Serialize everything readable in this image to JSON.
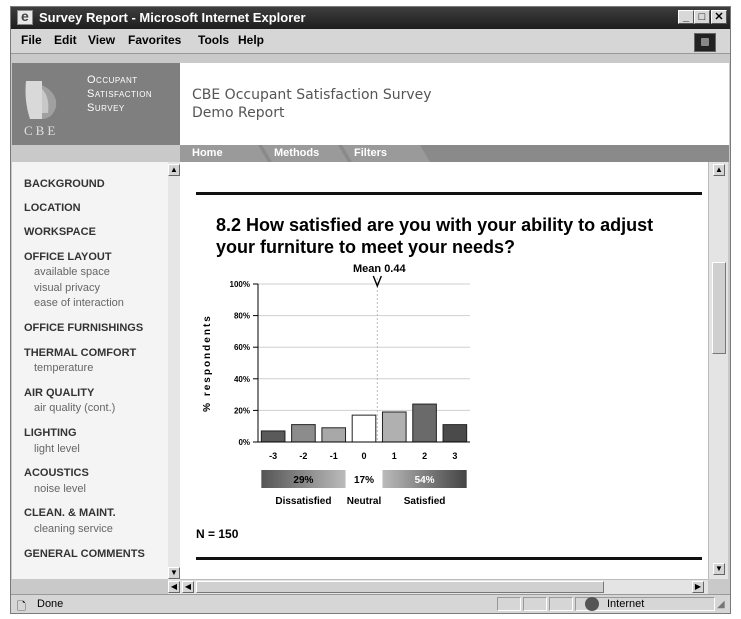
{
  "window": {
    "title": "Survey Report - Microsoft Internet Explorer",
    "controls": [
      "_",
      "□",
      "✕"
    ]
  },
  "menu": [
    "File",
    "Edit",
    "View",
    "Favorites",
    "Tools",
    "Help"
  ],
  "header": {
    "logo_lines": [
      "Occupant",
      "Satisfaction",
      "Survey"
    ],
    "logo_mark": "CBE",
    "title_line1": "CBE Occupant Satisfaction Survey",
    "title_line2": "Demo Report"
  },
  "nav": {
    "tabs": [
      "Home",
      "Methods",
      "Filters"
    ]
  },
  "sidebar": {
    "items": [
      {
        "label": "BACKGROUND",
        "subs": []
      },
      {
        "label": "LOCATION",
        "subs": []
      },
      {
        "label": "WORKSPACE",
        "subs": []
      },
      {
        "label": "OFFICE LAYOUT",
        "subs": [
          "available space",
          "visual privacy",
          "ease of interaction"
        ]
      },
      {
        "label": "OFFICE FURNISHINGS",
        "subs": []
      },
      {
        "label": "THERMAL COMFORT",
        "subs": [
          "temperature"
        ]
      },
      {
        "label": "AIR QUALITY",
        "subs": [
          "air quality (cont.)"
        ]
      },
      {
        "label": "LIGHTING",
        "subs": [
          "light level"
        ]
      },
      {
        "label": "ACOUSTICS",
        "subs": [
          "noise level"
        ]
      },
      {
        "label": "CLEAN. & MAINT.",
        "subs": [
          "cleaning service"
        ]
      },
      {
        "label": "GENERAL COMMENTS",
        "subs": []
      }
    ]
  },
  "question": {
    "text": "8.2 How satisfied are you with your ability to adjust your furniture to meet your needs?",
    "n_label": "N = 150"
  },
  "chart_data": {
    "type": "bar",
    "categories": [
      "-3",
      "-2",
      "-1",
      "0",
      "1",
      "2",
      "3"
    ],
    "values": [
      7,
      11,
      9,
      17,
      19,
      24,
      11
    ],
    "ylabel": "% respondents",
    "ylim": [
      0,
      100
    ],
    "yticks": [
      "0%",
      "20%",
      "40%",
      "60%",
      "80%",
      "100%"
    ],
    "grid": true,
    "mean_label": "Mean 0.44",
    "mean_value": 0.44,
    "summary_percents": [
      "29%",
      "17%",
      "54%"
    ],
    "summary_labels": [
      "Dissatisfied",
      "Neutral",
      "Satisfied"
    ]
  },
  "status": {
    "left": "Done",
    "zone": "Internet"
  },
  "colors": {
    "titlebar": "#2a2a2a",
    "header_gray": "#7f7f7f",
    "nav_gray": "#8a8a8a",
    "bar_dissatisfied": "#555555",
    "bar_neutral": "#ffffff",
    "bar_satisfied": "#7a7a7a"
  }
}
